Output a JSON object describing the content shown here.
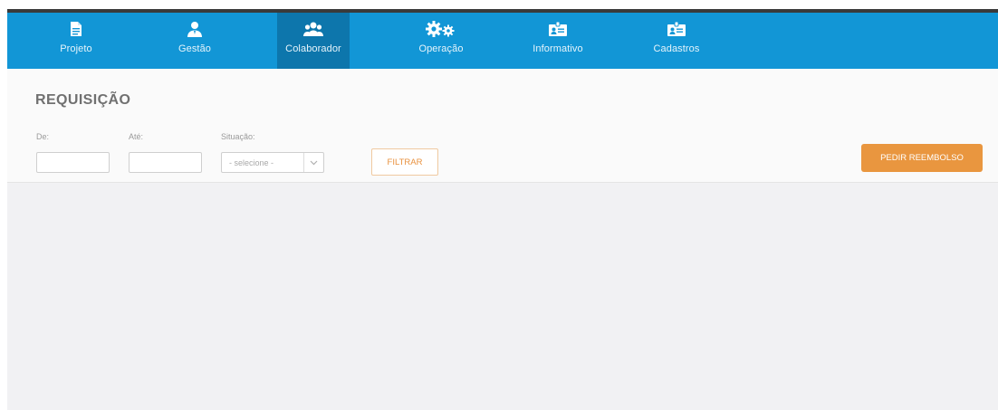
{
  "nav": {
    "items": [
      {
        "label": "Projeto",
        "icon": "document-icon",
        "active": false
      },
      {
        "label": "Gestão",
        "icon": "user-tie-icon",
        "active": false
      },
      {
        "label": "Colaborador",
        "icon": "users-group-icon",
        "active": true
      },
      {
        "label": "Operação",
        "icon": "gears-icon",
        "active": false
      },
      {
        "label": "Informativo",
        "icon": "id-card-icon",
        "active": false
      },
      {
        "label": "Cadastros",
        "icon": "id-card-icon",
        "active": false
      }
    ]
  },
  "page": {
    "title": "REQUISIÇÃO"
  },
  "filters": {
    "from_label": "De:",
    "from_value": "",
    "to_label": "Até:",
    "to_value": "",
    "status_label": "Situação:",
    "status_value": "- selecione -",
    "filter_button": "FILTRAR"
  },
  "actions": {
    "refund_button": "PEDIR REEMBOLSO"
  },
  "colors": {
    "nav_bg": "#1296d6",
    "nav_active_bg": "#0d76ac",
    "accent_orange": "#e9963f"
  }
}
